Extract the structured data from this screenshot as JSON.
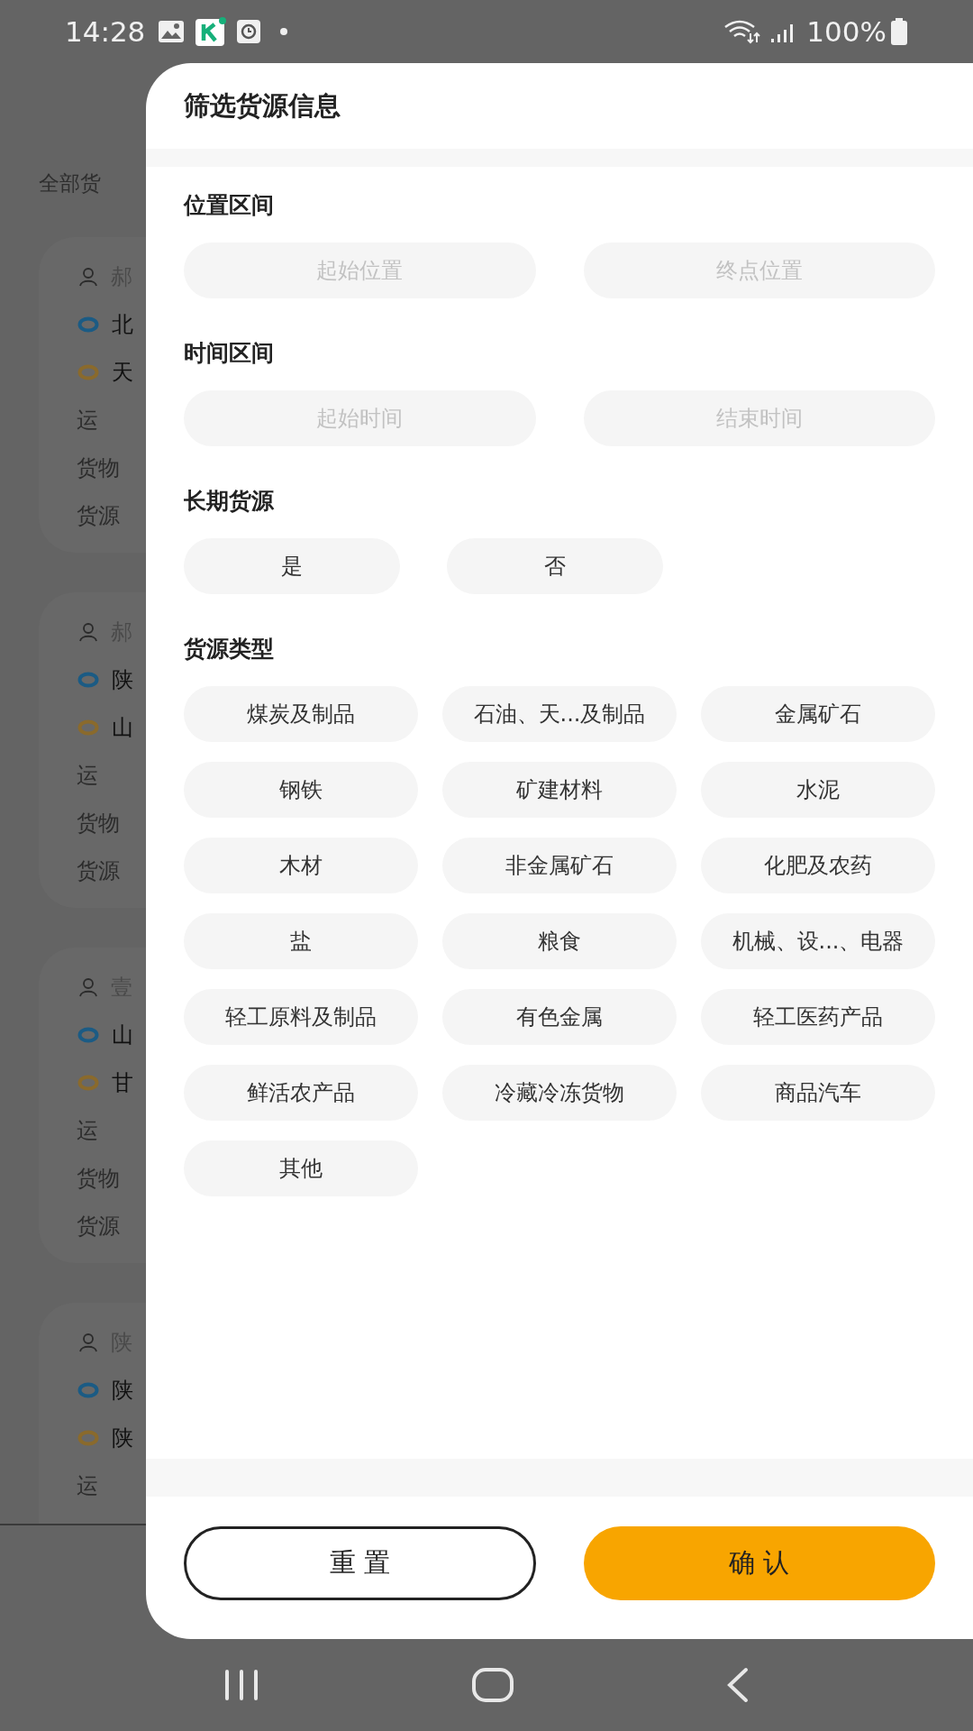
{
  "status_bar": {
    "time": "14:28",
    "battery": "100%"
  },
  "background": {
    "header": "全部货",
    "cards": [
      {
        "lines": [
          {
            "kind": "person",
            "text": "郝"
          },
          {
            "kind": "start",
            "text": "北"
          },
          {
            "kind": "end",
            "text": "天"
          },
          {
            "kind": "plain",
            "text": "运"
          },
          {
            "kind": "plain",
            "text": "货物"
          },
          {
            "kind": "plain",
            "text": "货源"
          }
        ]
      },
      {
        "lines": [
          {
            "kind": "person",
            "text": "郝"
          },
          {
            "kind": "start",
            "text": "陕"
          },
          {
            "kind": "end",
            "text": "山"
          },
          {
            "kind": "plain",
            "text": "运"
          },
          {
            "kind": "plain",
            "text": "货物"
          },
          {
            "kind": "plain",
            "text": "货源"
          }
        ]
      },
      {
        "lines": [
          {
            "kind": "person",
            "text": "壹"
          },
          {
            "kind": "start",
            "text": "山"
          },
          {
            "kind": "end",
            "text": "甘"
          },
          {
            "kind": "plain",
            "text": "运"
          },
          {
            "kind": "plain",
            "text": "货物"
          },
          {
            "kind": "plain",
            "text": "货源"
          }
        ]
      },
      {
        "lines": [
          {
            "kind": "person",
            "text": "陕"
          },
          {
            "kind": "start",
            "text": "陕"
          },
          {
            "kind": "end",
            "text": "陕"
          },
          {
            "kind": "plain",
            "text": "运"
          }
        ]
      }
    ]
  },
  "filter": {
    "title": "筛选货源信息",
    "sections": [
      {
        "kind": "range",
        "title": "位置区间",
        "fields": [
          {
            "placeholder": "起始位置"
          },
          {
            "placeholder": "终点位置"
          }
        ]
      },
      {
        "kind": "range",
        "title": "时间区间",
        "fields": [
          {
            "placeholder": "起始时间"
          },
          {
            "placeholder": "结束时间"
          }
        ]
      },
      {
        "kind": "choice",
        "title": "长期货源",
        "options": [
          {
            "label": "是",
            "selected": false
          },
          {
            "label": "否",
            "selected": false
          }
        ]
      },
      {
        "kind": "grid",
        "title": "货源类型",
        "options": [
          {
            "label": "煤炭及制品",
            "selected": false
          },
          {
            "label": "石油、天...及制品",
            "selected": false
          },
          {
            "label": "金属矿石",
            "selected": false
          },
          {
            "label": "钢铁",
            "selected": false
          },
          {
            "label": "矿建材料",
            "selected": false
          },
          {
            "label": "水泥",
            "selected": false
          },
          {
            "label": "木材",
            "selected": false
          },
          {
            "label": "非金属矿石",
            "selected": false
          },
          {
            "label": "化肥及农药",
            "selected": false
          },
          {
            "label": "盐",
            "selected": false
          },
          {
            "label": "粮食",
            "selected": false
          },
          {
            "label": "机械、设...、电器",
            "selected": false
          },
          {
            "label": "轻工原料及制品",
            "selected": false
          },
          {
            "label": "有色金属",
            "selected": false
          },
          {
            "label": "轻工医药产品",
            "selected": false
          },
          {
            "label": "鲜活农产品",
            "selected": false
          },
          {
            "label": "冷藏冷冻货物",
            "selected": false
          },
          {
            "label": "商品汽车",
            "selected": false
          },
          {
            "label": "其他",
            "selected": false
          }
        ]
      }
    ],
    "buttons": [
      {
        "kind": "outline",
        "label": "重 置"
      },
      {
        "kind": "primary",
        "label": "确 认"
      }
    ]
  }
}
